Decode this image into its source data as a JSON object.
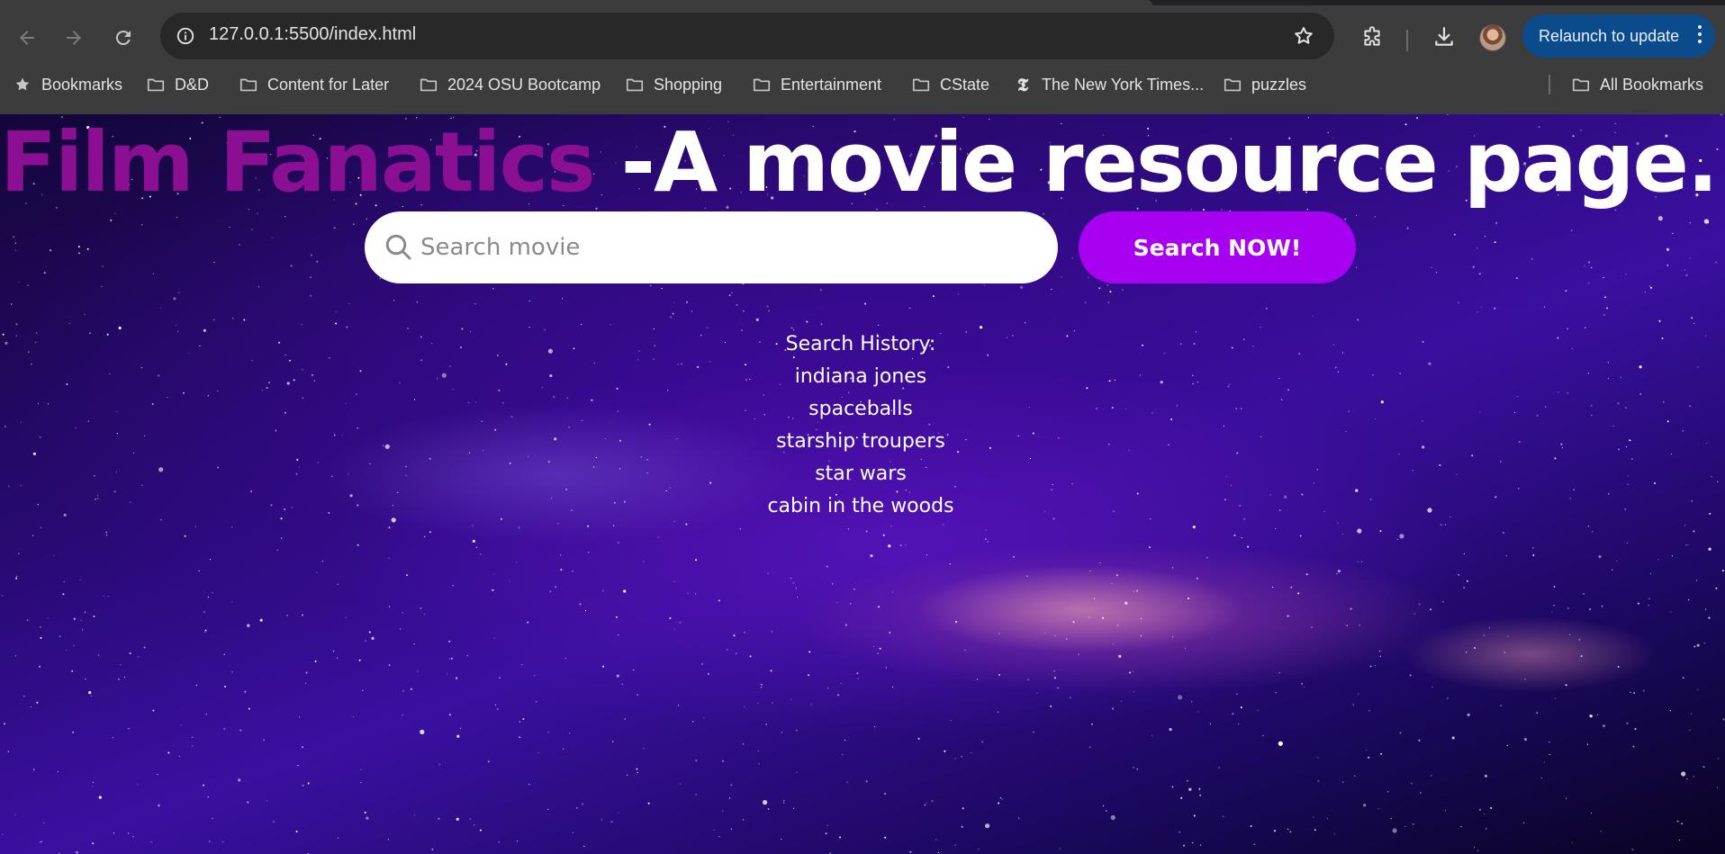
{
  "browser": {
    "url": "127.0.0.1:5500/index.html",
    "relaunch_label": "Relaunch to update",
    "bookmarks": [
      {
        "label": "Bookmarks",
        "icon": "star-icon"
      },
      {
        "label": "D&D",
        "icon": "folder-icon"
      },
      {
        "label": "Content for Later",
        "icon": "folder-icon"
      },
      {
        "label": "2024 OSU Bootcamp",
        "icon": "folder-icon"
      },
      {
        "label": "Shopping",
        "icon": "folder-icon"
      },
      {
        "label": "Entertainment",
        "icon": "folder-icon"
      },
      {
        "label": "CState",
        "icon": "folder-icon"
      },
      {
        "label": "The New York Times...",
        "icon": "nyt-icon"
      },
      {
        "label": "puzzles",
        "icon": "folder-icon"
      }
    ],
    "all_bookmarks_label": "All Bookmarks"
  },
  "page": {
    "brand": "Film Fanatics",
    "tagline": " -A movie resource page.",
    "brand_color": "#8a0f93",
    "search": {
      "placeholder": "Search movie",
      "button_label": "Search NOW!",
      "button_color": "#a800f0"
    },
    "history": {
      "title": "Search History:",
      "items": [
        "indiana jones",
        "spaceballs",
        "starship troupers",
        "star wars",
        "cabin in the woods"
      ]
    }
  }
}
